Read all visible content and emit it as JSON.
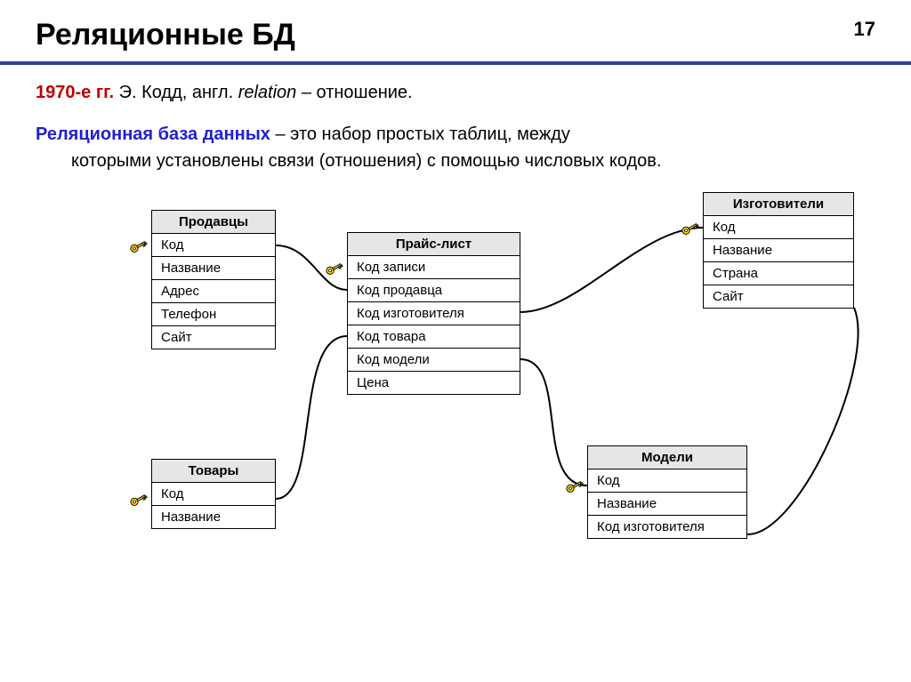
{
  "page_number": "17",
  "title": "Реляционные БД",
  "intro": {
    "years": "1970-е гг.",
    "rest1": " Э. Кодд, англ. ",
    "italic": "relation",
    "rest2": " – отношение."
  },
  "def": {
    "term": "Реляционная база данных",
    "dash": " – ",
    "body_first": "это набор простых таблиц, между",
    "body_rest": "которыми установлены связи (отношения) с помощью числовых кодов."
  },
  "tables": {
    "sellers": {
      "title": "Продавцы",
      "rows": [
        "Код",
        "Название",
        "Адрес",
        "Телефон",
        "Сайт"
      ]
    },
    "pricelist": {
      "title": "Прайс-лист",
      "rows": [
        "Код записи",
        "Код продавца",
        "Код изготовителя",
        "Код товара",
        "Код модели",
        "Цена"
      ]
    },
    "makers": {
      "title": "Изготовители",
      "rows": [
        "Код",
        "Название",
        "Страна",
        "Сайт"
      ]
    },
    "goods": {
      "title": "Товары",
      "rows": [
        "Код",
        "Название"
      ]
    },
    "models": {
      "title": "Модели",
      "rows": [
        "Код",
        "Название",
        "Код изготовителя"
      ]
    }
  }
}
